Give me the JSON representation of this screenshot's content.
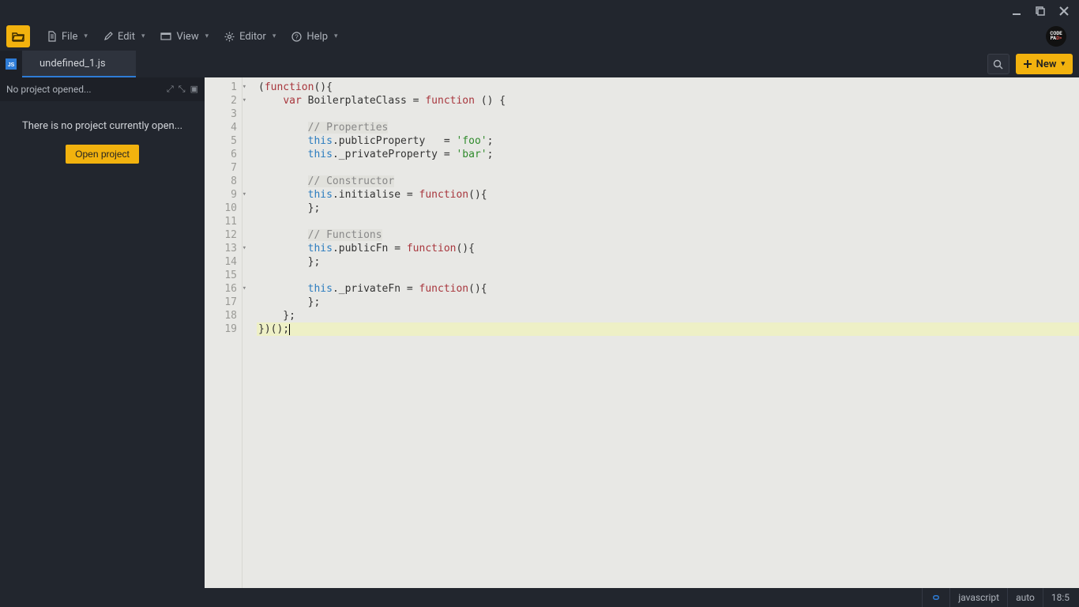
{
  "menus": {
    "file": "File",
    "edit": "Edit",
    "view": "View",
    "editor": "Editor",
    "help": "Help"
  },
  "tab": {
    "label": "undefined_1.js"
  },
  "toolbar": {
    "new_label": "New"
  },
  "sidebar": {
    "header": "No project opened...",
    "message": "There is no project currently open...",
    "open_btn": "Open project"
  },
  "status": {
    "language": "javascript",
    "encoding_mode": "auto",
    "cursor": "18:5"
  },
  "code": {
    "lines": [
      {
        "n": 1,
        "fold": true,
        "seg": [
          [
            "plain",
            "("
          ],
          [
            "kw1",
            "function"
          ],
          [
            "plain",
            "(){"
          ]
        ]
      },
      {
        "n": 2,
        "fold": true,
        "seg": [
          [
            "plain",
            "    "
          ],
          [
            "kw1",
            "var"
          ],
          [
            "plain",
            " BoilerplateClass = "
          ],
          [
            "kw1",
            "function"
          ],
          [
            "plain",
            " () {"
          ]
        ]
      },
      {
        "n": 3,
        "fold": false,
        "seg": []
      },
      {
        "n": 4,
        "fold": false,
        "seg": [
          [
            "plain",
            "        "
          ],
          [
            "cmt",
            "// Properties"
          ]
        ]
      },
      {
        "n": 5,
        "fold": false,
        "seg": [
          [
            "plain",
            "        "
          ],
          [
            "kw2",
            "this"
          ],
          [
            "plain",
            ".publicProperty   = "
          ],
          [
            "str",
            "'foo'"
          ],
          [
            "plain",
            ";"
          ]
        ]
      },
      {
        "n": 6,
        "fold": false,
        "seg": [
          [
            "plain",
            "        "
          ],
          [
            "kw2",
            "this"
          ],
          [
            "plain",
            "._privateProperty = "
          ],
          [
            "str",
            "'bar'"
          ],
          [
            "plain",
            ";"
          ]
        ]
      },
      {
        "n": 7,
        "fold": false,
        "seg": []
      },
      {
        "n": 8,
        "fold": false,
        "seg": [
          [
            "plain",
            "        "
          ],
          [
            "cmt",
            "// Constructor"
          ]
        ]
      },
      {
        "n": 9,
        "fold": true,
        "seg": [
          [
            "plain",
            "        "
          ],
          [
            "kw2",
            "this"
          ],
          [
            "plain",
            ".initialise = "
          ],
          [
            "kw1",
            "function"
          ],
          [
            "plain",
            "(){"
          ]
        ]
      },
      {
        "n": 10,
        "fold": false,
        "seg": [
          [
            "plain",
            "        };"
          ]
        ]
      },
      {
        "n": 11,
        "fold": false,
        "seg": []
      },
      {
        "n": 12,
        "fold": false,
        "seg": [
          [
            "plain",
            "        "
          ],
          [
            "cmt",
            "// Functions"
          ]
        ]
      },
      {
        "n": 13,
        "fold": true,
        "seg": [
          [
            "plain",
            "        "
          ],
          [
            "kw2",
            "this"
          ],
          [
            "plain",
            ".publicFn = "
          ],
          [
            "kw1",
            "function"
          ],
          [
            "plain",
            "(){"
          ]
        ]
      },
      {
        "n": 14,
        "fold": false,
        "seg": [
          [
            "plain",
            "        };"
          ]
        ]
      },
      {
        "n": 15,
        "fold": false,
        "seg": []
      },
      {
        "n": 16,
        "fold": true,
        "seg": [
          [
            "plain",
            "        "
          ],
          [
            "kw2",
            "this"
          ],
          [
            "plain",
            "._privateFn = "
          ],
          [
            "kw1",
            "function"
          ],
          [
            "plain",
            "(){"
          ]
        ]
      },
      {
        "n": 17,
        "fold": false,
        "seg": [
          [
            "plain",
            "        };"
          ]
        ]
      },
      {
        "n": 18,
        "fold": false,
        "seg": [
          [
            "plain",
            "    };"
          ]
        ]
      },
      {
        "n": 19,
        "fold": false,
        "active": true,
        "seg": [
          [
            "plain",
            "})();"
          ]
        ]
      }
    ]
  }
}
